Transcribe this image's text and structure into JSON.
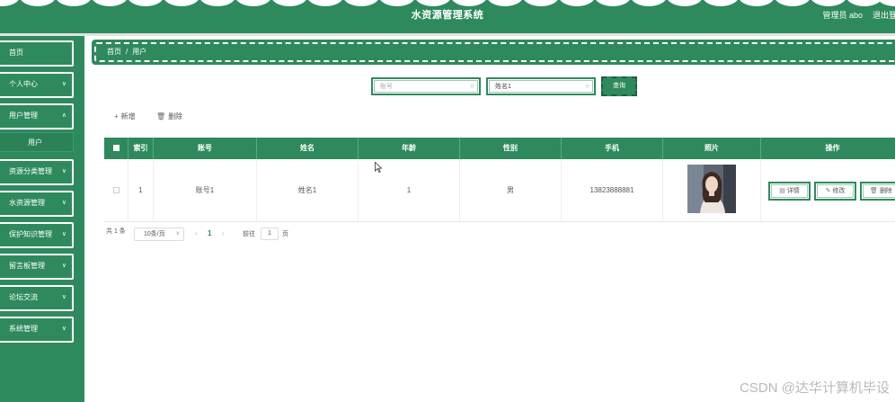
{
  "header": {
    "title": "水资源管理系统",
    "user": "管理员 abo",
    "logout": "退出登"
  },
  "sidebar": {
    "items": [
      {
        "label": "首页"
      },
      {
        "label": "个人中心"
      },
      {
        "label": "用户管理"
      },
      {
        "label": "资源分类管理"
      },
      {
        "label": "水资源管理"
      },
      {
        "label": "保护知识管理"
      },
      {
        "label": "留言板管理"
      },
      {
        "label": "论坛交流"
      },
      {
        "label": "系统管理"
      }
    ],
    "subitem": "用户"
  },
  "breadcrumb": {
    "home": "首页",
    "separator": "/",
    "current": "用户"
  },
  "search": {
    "account_placeholder": "账号",
    "name_value": "姓名1",
    "button": "查询"
  },
  "actions": {
    "add": "新增",
    "delete": "删除"
  },
  "table": {
    "columns": [
      "索引",
      "账号",
      "姓名",
      "年龄",
      "性别",
      "手机",
      "照片",
      "操作"
    ],
    "rows": [
      {
        "index": "1",
        "account": "账号1",
        "name": "姓名1",
        "age": "1",
        "gender": "男",
        "phone": "13823888881"
      }
    ],
    "ops": {
      "detail": "详情",
      "edit": "修改",
      "delete": "删除"
    }
  },
  "pagination": {
    "total": "共 1 条",
    "page_size": "10条/页",
    "current_page": "1",
    "goto_prefix": "前往",
    "goto_value": "1",
    "goto_suffix": "页"
  },
  "watermark": "CSDN @达华计算机毕设",
  "colors": {
    "primary": "#2e8a5d",
    "border_light": "#9ec9b2"
  }
}
